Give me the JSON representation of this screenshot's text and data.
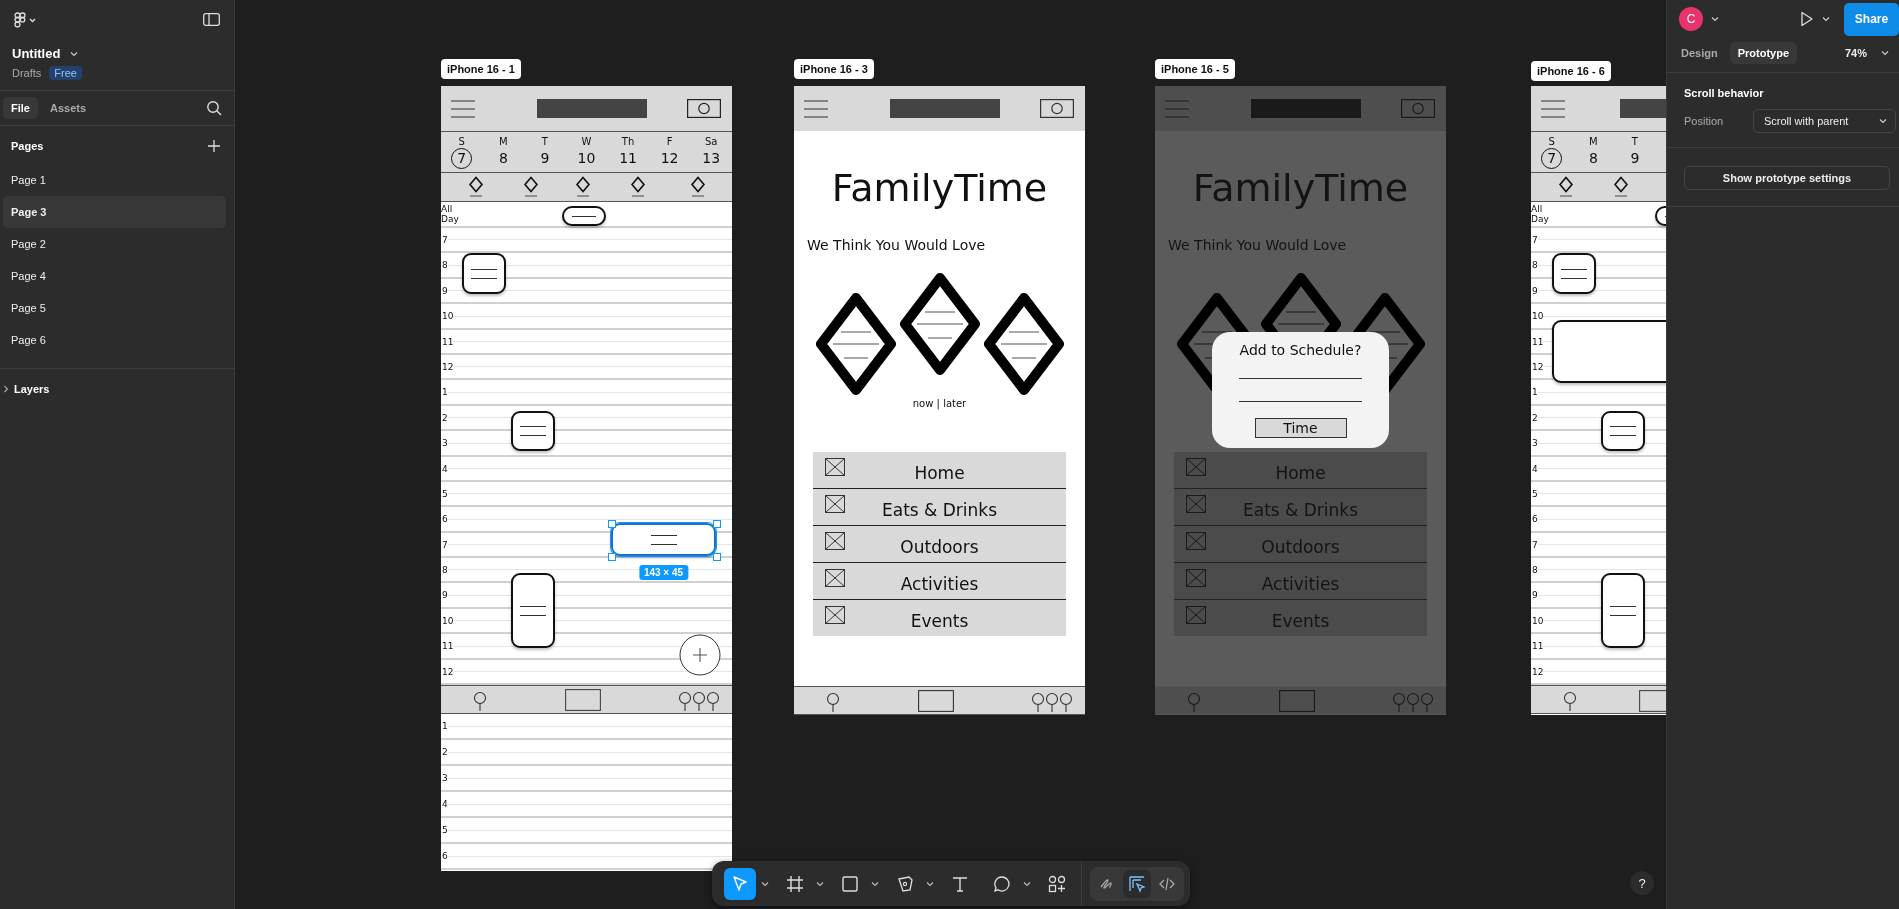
{
  "file": {
    "name": "Untitled",
    "location": "Drafts",
    "plan": "Free"
  },
  "left_tabs": [
    {
      "label": "File",
      "selected": true
    },
    {
      "label": "Assets",
      "selected": false
    }
  ],
  "pages": {
    "heading": "Pages",
    "items": [
      {
        "label": "Page 1",
        "selected": false
      },
      {
        "label": "Page 3",
        "selected": true
      },
      {
        "label": "Page 2",
        "selected": false
      },
      {
        "label": "Page 4",
        "selected": false
      },
      {
        "label": "Page 5",
        "selected": false
      },
      {
        "label": "Page 6",
        "selected": false
      }
    ]
  },
  "layers": {
    "heading": "Layers",
    "expanded": false
  },
  "frames": [
    {
      "kind": "calendar",
      "label": "iPhone 16 - 1",
      "days": [
        {
          "weekday": "S",
          "date": "7",
          "selected": true
        },
        {
          "weekday": "M",
          "date": "8",
          "selected": false
        },
        {
          "weekday": "T",
          "date": "9",
          "selected": false
        },
        {
          "weekday": "W",
          "date": "10",
          "selected": false
        },
        {
          "weekday": "Th",
          "date": "11",
          "selected": false
        },
        {
          "weekday": "F",
          "date": "12",
          "selected": false
        },
        {
          "weekday": "Sa",
          "date": "13",
          "selected": false
        }
      ],
      "all_day": "All Day",
      "hours": [
        "7",
        "8",
        "9",
        "10",
        "11",
        "12",
        "1",
        "2",
        "3",
        "4",
        "5",
        "6",
        "7",
        "8",
        "9",
        "10",
        "11",
        "12"
      ],
      "later_hours": [
        "1",
        "2",
        "3",
        "4",
        "5",
        "6"
      ],
      "events": [
        {
          "kind": "pill",
          "selected": false
        },
        {
          "kind": "block",
          "selected": false
        },
        {
          "kind": "block",
          "selected": false
        },
        {
          "kind": "block",
          "selected": true
        },
        {
          "kind": "block",
          "selected": false
        }
      ],
      "selection_size": "143 × 45"
    },
    {
      "kind": "home",
      "label": "iPhone 16 - 3",
      "dimmed": false,
      "title": "FamilyTime",
      "subtitle": "We Think You Would Love",
      "toggle": "now | later",
      "menu": [
        "Home",
        "Eats & Drinks",
        "Outdoors",
        "Activities",
        "Events"
      ]
    },
    {
      "kind": "home",
      "label": "iPhone 16 - 5",
      "dimmed": true,
      "title": "FamilyTime",
      "subtitle": "We Think You Would Love",
      "menu": [
        "Home",
        "Eats & Drinks",
        "Outdoors",
        "Activities",
        "Events"
      ],
      "dialog": {
        "title": "Add to Schedule?",
        "button": "Time"
      }
    },
    {
      "kind": "calendar",
      "label": "iPhone 16 - 6",
      "days": [
        {
          "weekday": "S",
          "date": "7",
          "selected": true
        },
        {
          "weekday": "M",
          "date": "8",
          "selected": false
        },
        {
          "weekday": "T",
          "date": "9",
          "selected": false
        }
      ],
      "all_day": "All Day",
      "hours": [
        "7",
        "8",
        "9",
        "10",
        "11",
        "12",
        "1",
        "2",
        "3",
        "4",
        "5",
        "6",
        "7",
        "8",
        "9",
        "10",
        "11",
        "12"
      ],
      "events": [
        {
          "kind": "pill",
          "selected": false
        },
        {
          "kind": "block",
          "selected": false
        },
        {
          "kind": "wide",
          "selected": false
        },
        {
          "kind": "block",
          "selected": false
        },
        {
          "kind": "block",
          "selected": false
        }
      ]
    }
  ],
  "right_panel": {
    "avatar": "C",
    "share": "Share",
    "tabs": [
      {
        "label": "Design",
        "selected": false
      },
      {
        "label": "Prototype",
        "selected": true
      }
    ],
    "zoom": "74%",
    "section": "Scroll behavior",
    "field_label": "Position",
    "field_value": "Scroll with parent",
    "settings_button": "Show prototype settings"
  },
  "toolbar": {
    "tools": [
      {
        "kind": "move",
        "selected": true
      },
      {
        "kind": "frame",
        "selected": false
      },
      {
        "kind": "shape",
        "selected": false
      },
      {
        "kind": "pen",
        "selected": false
      },
      {
        "kind": "text",
        "selected": false
      },
      {
        "kind": "comment",
        "selected": false
      },
      {
        "kind": "actions",
        "selected": false
      }
    ],
    "modes": [
      {
        "kind": "draw",
        "selected": false
      },
      {
        "kind": "design",
        "selected": true
      },
      {
        "kind": "dev",
        "selected": false
      }
    ]
  },
  "help": "?"
}
